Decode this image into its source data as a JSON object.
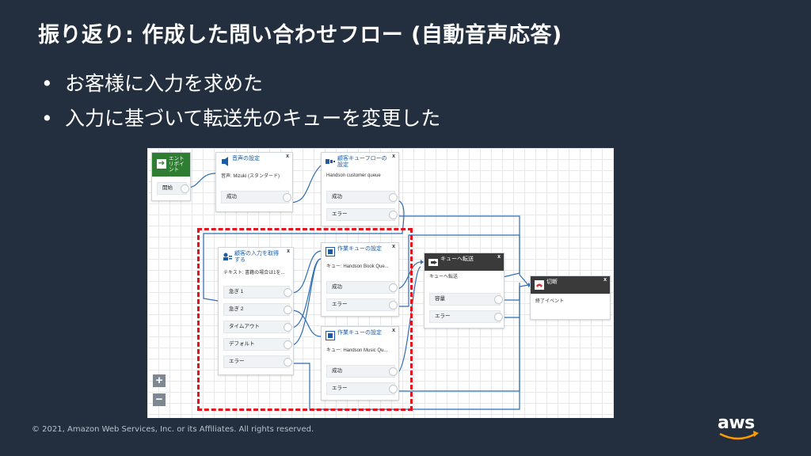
{
  "slide": {
    "title": "振り返り: 作成した問い合わせフロー (自動音声応答)",
    "bullets": [
      "お客様に入力を求めた",
      "入力に基づいて転送先のキューを変更した"
    ],
    "footer": "© 2021, Amazon Web Services, Inc. or its Affiliates. All rights reserved.",
    "logo_text": "aws"
  },
  "flow": {
    "entry": {
      "title_line1": "エント",
      "title_line2": "リポイ",
      "title_line3": "ント",
      "port": "開始"
    },
    "voice": {
      "title": "音声の設定",
      "desc": "音声: Mizuki (スタンダード)",
      "port": "成功"
    },
    "customer_queue": {
      "title": "顧客キューフローの設定",
      "desc": "Handson customer queue",
      "ports": [
        "成功",
        "エラー"
      ]
    },
    "get_input": {
      "title": "顧客の入力を取得する",
      "desc": "テキスト: 書籍の場合は1を...",
      "ports": [
        "急ぎ 1",
        "急ぎ 2",
        "タイムアウト",
        "デフォルト",
        "エラー"
      ]
    },
    "work_queue_1": {
      "title": "作業キューの設定",
      "desc": "キュー: Handson Book Que...",
      "ports": [
        "成功",
        "エラー"
      ]
    },
    "work_queue_2": {
      "title": "作業キューの設定",
      "desc": "キュー: Handson Music Qu...",
      "ports": [
        "成功",
        "エラー"
      ]
    },
    "transfer": {
      "title": "キューへ転送",
      "desc": "キューへ転送",
      "ports": [
        "容量",
        "エラー"
      ]
    },
    "disconnect": {
      "title": "切断",
      "desc": "終了イベント"
    },
    "close_glyph": "x",
    "zoom": {
      "in": "+",
      "out": "−"
    }
  },
  "colors": {
    "background": "#232f3e",
    "highlight_dashed": "#e3121d",
    "connector": "#2f6db5",
    "entry_green": "#2e7d32"
  }
}
